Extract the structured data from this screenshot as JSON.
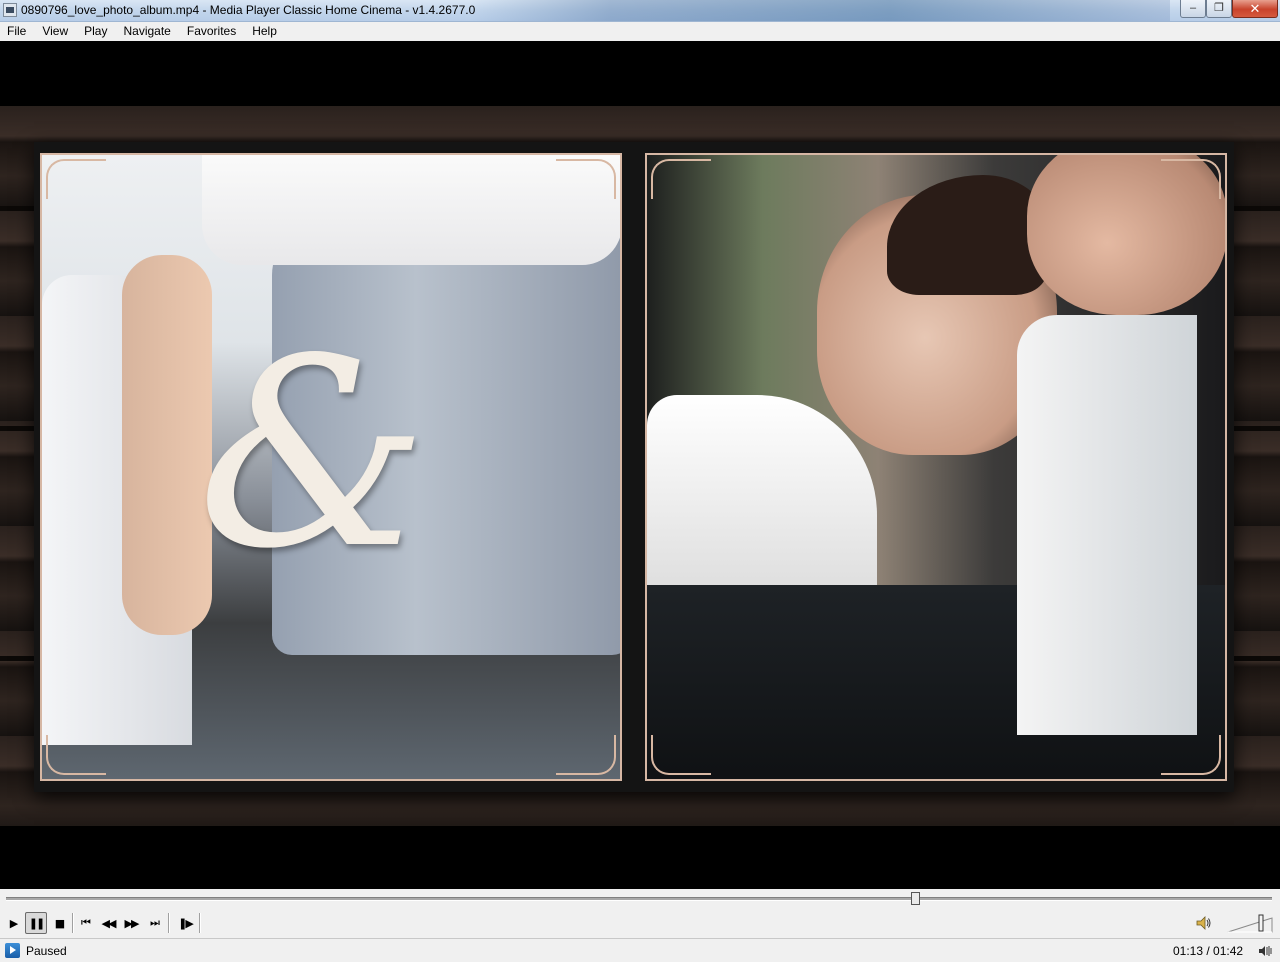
{
  "window": {
    "title": "0890796_love_photo_album.mp4 - Media Player Classic Home Cinema - v1.4.2677.0",
    "minimize_label": "–",
    "maximize_label": "❐",
    "close_label": "✕"
  },
  "menu": {
    "items": [
      {
        "label": "File"
      },
      {
        "label": "View"
      },
      {
        "label": "Play"
      },
      {
        "label": "Navigate"
      },
      {
        "label": "Favorites"
      },
      {
        "label": "Help"
      }
    ]
  },
  "video": {
    "ampersand": "&"
  },
  "seek": {
    "position_fraction": 0.7179
  },
  "toolbar": {
    "play_glyph": "▶",
    "pause_glyph": "❚❚",
    "stop_glyph": "■",
    "prev_glyph": "⏮",
    "rewind_glyph": "◀◀",
    "forward_glyph": "▶▶",
    "next_glyph": "⏭",
    "frame_step_glyph": "❚▶",
    "volume_level": 0.75
  },
  "status": {
    "state": "Paused",
    "time": "01:13 / 01:42"
  }
}
